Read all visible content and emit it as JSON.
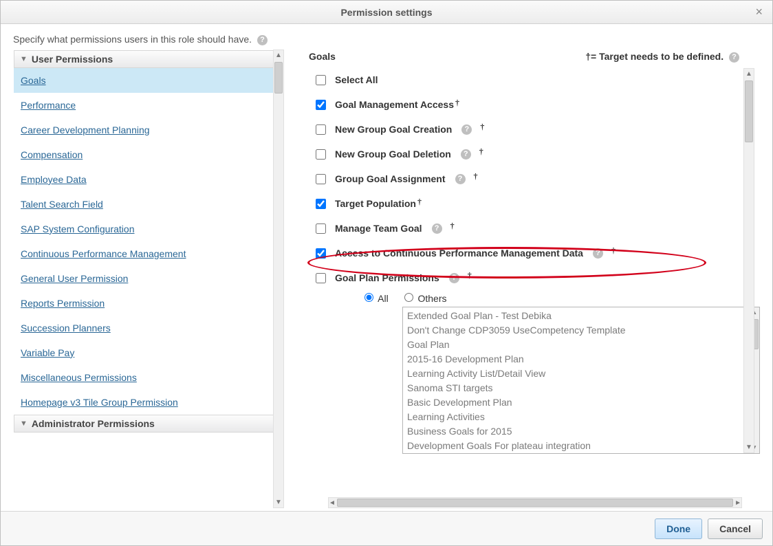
{
  "dialog": {
    "title": "Permission settings"
  },
  "instruction": "Specify what permissions users in this role should have.",
  "sidebar": {
    "sections": [
      {
        "label": "User Permissions",
        "expanded": true
      },
      {
        "label": "Administrator Permissions",
        "expanded": false
      }
    ],
    "items": [
      {
        "label": "Goals",
        "selected": true
      },
      {
        "label": "Performance"
      },
      {
        "label": "Career Development Planning"
      },
      {
        "label": "Compensation"
      },
      {
        "label": "Employee Data"
      },
      {
        "label": "Talent Search Field"
      },
      {
        "label": "SAP System Configuration"
      },
      {
        "label": "Continuous Performance Management"
      },
      {
        "label": "General User Permission"
      },
      {
        "label": "Reports Permission"
      },
      {
        "label": "Succession Planners"
      },
      {
        "label": "Variable Pay"
      },
      {
        "label": "Miscellaneous Permissions"
      },
      {
        "label": "Homepage v3 Tile Group Permission"
      }
    ]
  },
  "right": {
    "title": "Goals",
    "legend": "†= Target needs to be defined.",
    "dagger": "†",
    "permissions": [
      {
        "label": "Select All",
        "checked": false,
        "help": false,
        "dagger": false
      },
      {
        "label": "Goal Management Access",
        "checked": true,
        "help": false,
        "dagger": true
      },
      {
        "label": "New Group Goal Creation",
        "checked": false,
        "help": true,
        "dagger": true
      },
      {
        "label": "New Group Goal Deletion",
        "checked": false,
        "help": true,
        "dagger": true
      },
      {
        "label": "Group Goal Assignment",
        "checked": false,
        "help": true,
        "dagger": true
      },
      {
        "label": "Target Population",
        "checked": true,
        "help": false,
        "dagger": true
      },
      {
        "label": "Manage Team Goal",
        "checked": false,
        "help": true,
        "dagger": true
      },
      {
        "label": "Access to Continuous Performance Management Data",
        "checked": true,
        "help": true,
        "dagger": true
      },
      {
        "label": "Goal Plan Permissions",
        "checked": false,
        "help": true,
        "dagger": true
      }
    ],
    "radios": {
      "all": "All",
      "others": "Others",
      "selected": "all"
    },
    "plans": [
      "Extended Goal Plan - Test Debika",
      "Don't Change CDP3059 UseCompetency Template",
      "Goal Plan",
      "2015-16 Development Plan",
      "Learning Activity List/Detail View",
      "Sanoma STI targets",
      "Basic Development Plan",
      "Learning Activities",
      "Business Goals for 2015",
      "Development Goals For plateau integration"
    ]
  },
  "footer": {
    "done": "Done",
    "cancel": "Cancel"
  },
  "glyphs": {
    "close": "×",
    "help": "?",
    "chev_down": "▼",
    "up": "▲",
    "down": "▼",
    "left": "◄",
    "right": "►"
  }
}
